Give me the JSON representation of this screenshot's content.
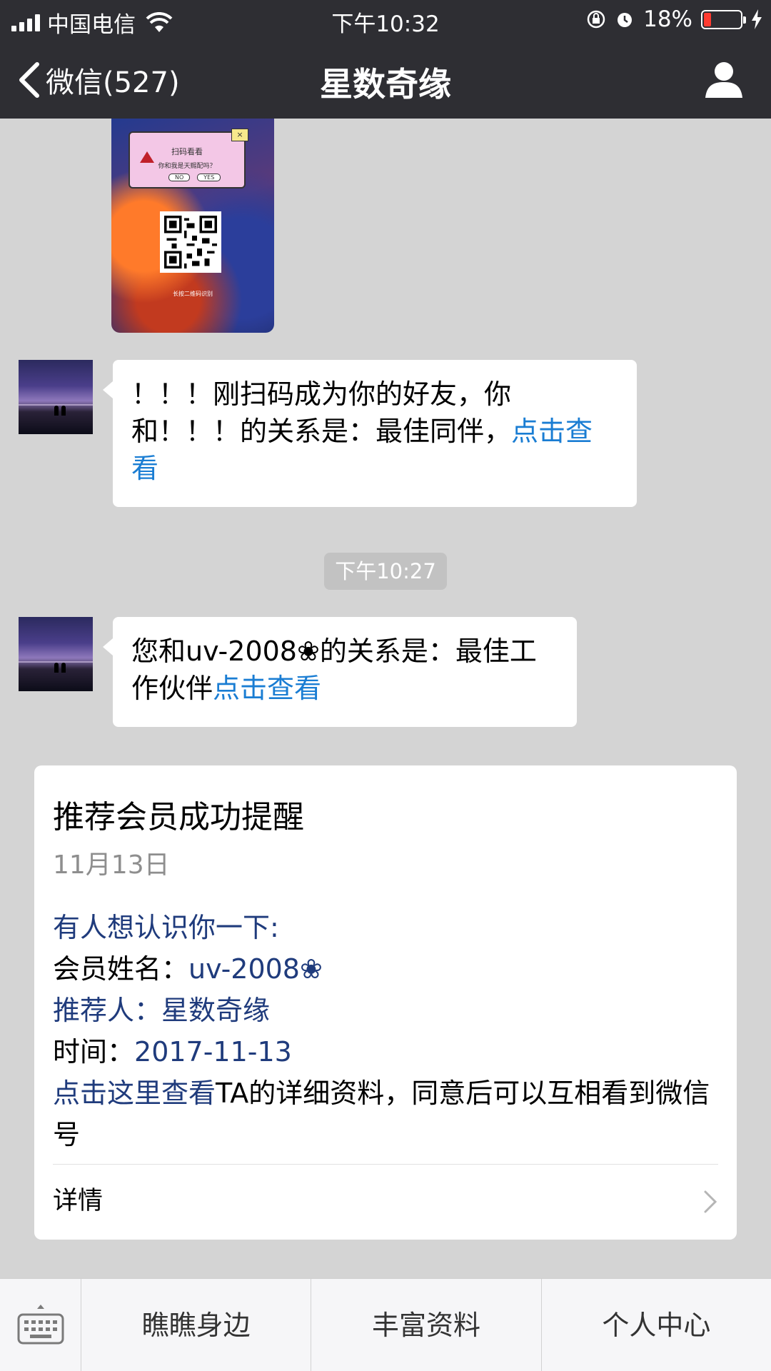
{
  "status_bar": {
    "carrier": "中国电信",
    "time": "下午10:32",
    "battery": "18%"
  },
  "nav": {
    "back_label": "微信(527)",
    "title": "星数奇缘"
  },
  "poster": {
    "dialog_title": "扫码看看",
    "dialog_text": "你和我是天赐配吗？",
    "btn_no": "NO",
    "btn_yes": "YES",
    "caption": "长按二维码识别"
  },
  "messages": [
    {
      "text": "！！！刚扫码成为你的好友，你和！！！的关系是：最佳同伴，",
      "link": "点击查看"
    },
    {
      "text": "您和uv-2008",
      "text_after": "的关系是：最佳工作伙伴",
      "link": "点击查看"
    }
  ],
  "timestamp": "下午10:27",
  "card": {
    "title": "推荐会员成功提醒",
    "date": "11月13日",
    "line1": "有人想认识你一下:",
    "name_label": "会员姓名：",
    "name_value": "uv-2008",
    "referrer_label": "推荐人：",
    "referrer_value": "星数奇缘",
    "time_label": "时间：",
    "time_value": "2017-11-13",
    "footer_link": "点击这里查看",
    "footer_text": "TA的详细资料，同意后可以互相看到微信号",
    "detail_label": "详情"
  },
  "bottom_menu": [
    "瞧瞧身边",
    "丰富资料",
    "个人中心"
  ],
  "colors": {
    "nav_bg": "#2e2e33",
    "chat_bg": "#d4d4d4",
    "link": "#1a7dd3",
    "card_value": "#1f3b7c",
    "battery_low": "#ff3b30"
  }
}
